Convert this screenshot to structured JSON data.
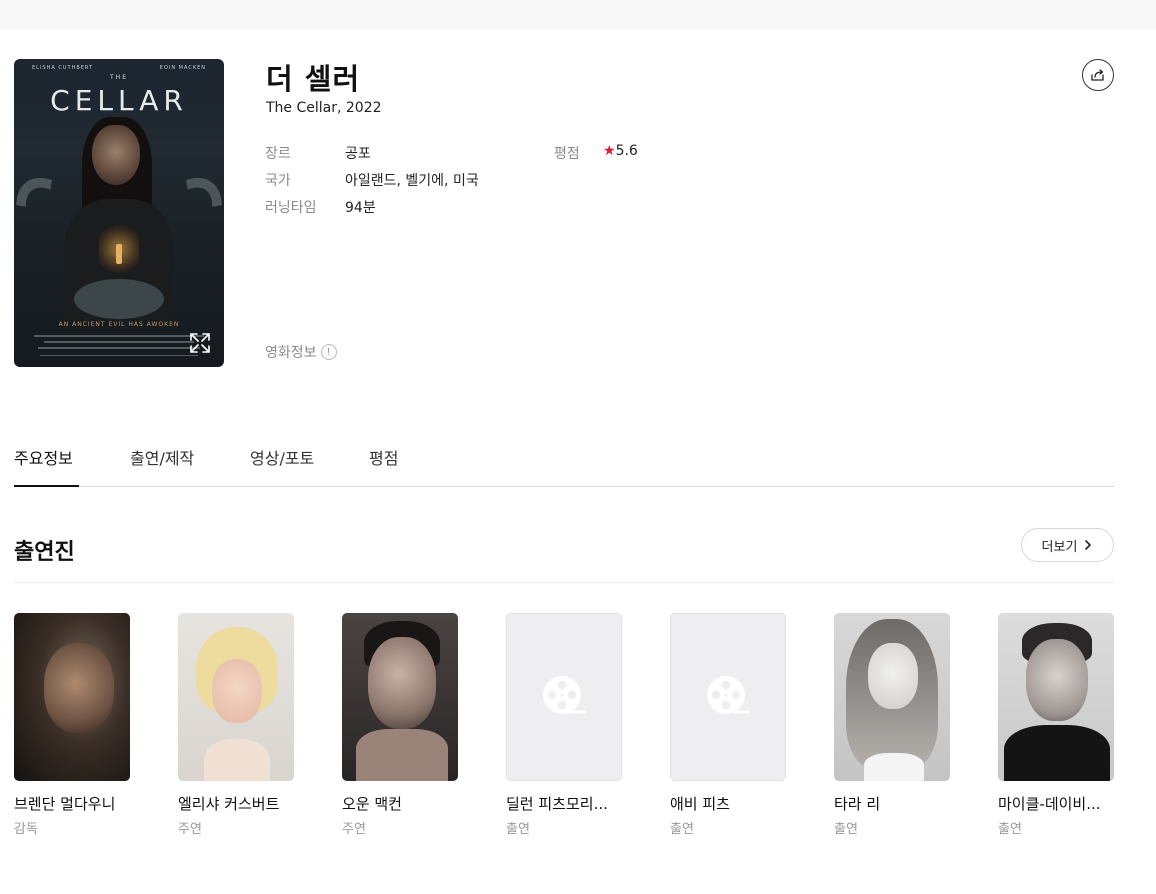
{
  "movie": {
    "title": "더 셀러",
    "subtitle": "The Cellar, 2022",
    "poster": {
      "credit_left": "ELISHA CUTHBERT",
      "credit_right": "EOIN MACKEN",
      "the": "THE",
      "title": "CELLAR",
      "tagline": "AN ANCIENT EVIL HAS AWOKEN"
    },
    "info": {
      "genre_label": "장르",
      "genre": "공포",
      "country_label": "국가",
      "country": "아일랜드, 벨기에, 미국",
      "runtime_label": "러닝타임",
      "runtime": "94분",
      "rating_label": "평점",
      "rating_star": "★",
      "rating": "5.6"
    },
    "movieinfo_label": "영화정보",
    "movieinfo_icon": "!"
  },
  "tabs": [
    {
      "label": "주요정보",
      "active": true
    },
    {
      "label": "출연/제작",
      "active": false
    },
    {
      "label": "영상/포토",
      "active": false
    },
    {
      "label": "평점",
      "active": false
    }
  ],
  "cast_section": {
    "title": "출연진",
    "more_label": "더보기",
    "members": [
      {
        "name": "브렌단 멀다우니",
        "role": "감독",
        "photo": "photo"
      },
      {
        "name": "엘리샤 커스버트",
        "role": "주연",
        "photo": "photo"
      },
      {
        "name": "오운 맥컨",
        "role": "주연",
        "photo": "photo"
      },
      {
        "name": "딜런 피츠모리...",
        "role": "출연",
        "photo": "film-reel-placeholder"
      },
      {
        "name": "애비 피츠",
        "role": "출연",
        "photo": "film-reel-placeholder"
      },
      {
        "name": "타라 리",
        "role": "출연",
        "photo": "photo"
      },
      {
        "name": "마이클-데이비...",
        "role": "출연",
        "photo": "photo"
      }
    ]
  },
  "colors": {
    "accent_star": "#e3173a",
    "label_gray": "#8a8a8a",
    "divider": "#d8d8d8"
  }
}
